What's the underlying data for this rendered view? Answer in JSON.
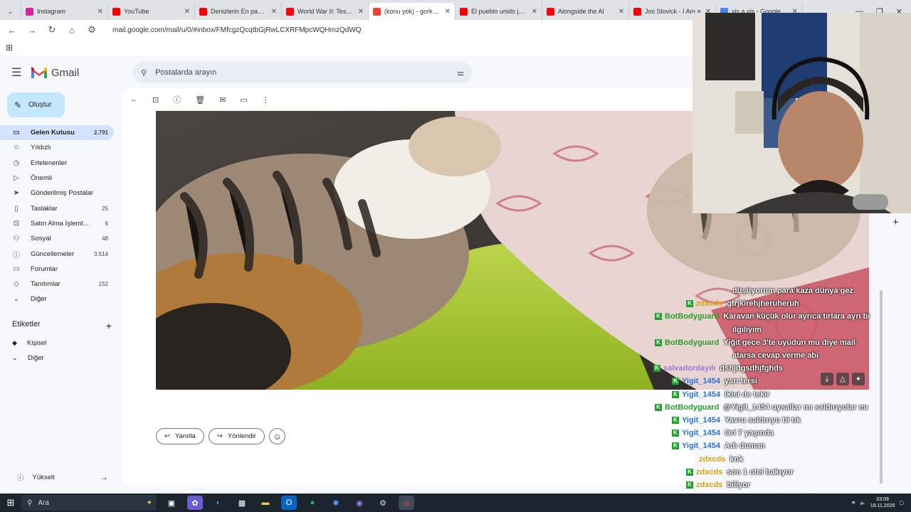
{
  "browser": {
    "tabs": [
      {
        "title": "Instagram",
        "color": "#d6249f"
      },
      {
        "title": "YouTube",
        "color": "#ff0000"
      },
      {
        "title": "Denizlerin En pahalı b",
        "color": "#ff0000"
      },
      {
        "title": "World War II: Test You",
        "color": "#ff0000"
      },
      {
        "title": "(konu yok) - gorkem",
        "color": "#ea4335"
      },
      {
        "title": "El pueblo unido jamá",
        "color": "#ff0000"
      },
      {
        "title": "Alongside the Al",
        "color": "#ff0000"
      },
      {
        "title": "Jos Slovick - I Am a",
        "color": "#ff0000"
      },
      {
        "title": "vis a vis - Google'da",
        "color": "#4285f4"
      }
    ],
    "url": "mail.google.com/mail/u/0/#inbox/FMfcgzQcqtbGjRwLCXRFMpcWQHmzQdWQ"
  },
  "gmail": {
    "app_name": "Gmail",
    "search_placeholder": "Postalarda arayın",
    "compose_label": "Oluştur",
    "nav": [
      {
        "label": "Gelen Kutusu",
        "count": "2.791",
        "icon": "inbox-icon",
        "glyph": "▭",
        "active": true
      },
      {
        "label": "Yıldızlı",
        "count": "",
        "icon": "star-icon",
        "glyph": "☆"
      },
      {
        "label": "Ertelenenler",
        "count": "",
        "icon": "clock-icon",
        "glyph": "◷"
      },
      {
        "label": "Önemli",
        "count": "",
        "icon": "important-icon",
        "glyph": "▷"
      },
      {
        "label": "Gönderilmiş Postalar",
        "count": "",
        "icon": "send-icon",
        "glyph": "➤"
      },
      {
        "label": "Taslaklar",
        "count": "25",
        "icon": "draft-icon",
        "glyph": "▯"
      },
      {
        "label": "Satın Alma İşleml...",
        "count": "6",
        "icon": "cart-icon",
        "glyph": "⊡"
      },
      {
        "label": "Sosyal",
        "count": "48",
        "icon": "people-icon",
        "glyph": "⚇"
      },
      {
        "label": "Güncellemeler",
        "count": "3.514",
        "icon": "info-icon",
        "glyph": "ⓘ"
      },
      {
        "label": "Forumlar",
        "count": "",
        "icon": "forum-icon",
        "glyph": "▭"
      },
      {
        "label": "Tanıtımlar",
        "count": "152",
        "icon": "tag-icon",
        "glyph": "◇"
      },
      {
        "label": "Diğer",
        "count": "",
        "icon": "chevron-down-icon",
        "glyph": "⌄"
      }
    ],
    "labels_title": "Etiketler",
    "labels": [
      {
        "label": "Kişisel",
        "glyph": "◆",
        "icon": "label-icon"
      },
      {
        "label": "Diğer",
        "glyph": "⌄",
        "icon": "chevron-down-icon"
      }
    ],
    "upgrade_label": "Yükselt",
    "reply_label": "Yanıtla",
    "forward_label": "Yönlendir"
  },
  "chat": [
    {
      "name": "",
      "badge": false,
      "color": "#ffffff",
      "text": "düşüyorum para kaza dünya gez",
      "indent": 117
    },
    {
      "name": "zdxcds",
      "badge": true,
      "color": "#d8a200",
      "text": "gtrjkirehjheruheruh",
      "indent": 52
    },
    {
      "name": "BotBodyguard",
      "badge": true,
      "color": "#2e9e2e",
      "text": "Karavan küçük olur ayrıca tırlara ayrı bi",
      "indent": 8
    },
    {
      "name": "",
      "badge": false,
      "color": "#ffffff",
      "text": "ilgiliyim",
      "indent": 117
    },
    {
      "name": "BotBodyguard",
      "badge": true,
      "color": "#2e9e2e",
      "text": "Yiğit gece 3'te uyudun mu diye mail",
      "indent": 8
    },
    {
      "name": "",
      "badge": false,
      "color": "#ffffff",
      "text": "atarsa cevap verme abi",
      "indent": 117
    },
    {
      "name": "salvadordayılı",
      "badge": true,
      "color": "#a07ad8",
      "text": "dshjdgsdhjfghds",
      "indent": 6
    },
    {
      "name": "Yigit_1454",
      "badge": true,
      "color": "#2c6fd6",
      "text": "yarı tersi",
      "indent": 32
    },
    {
      "name": "Yigit_1454",
      "badge": true,
      "color": "#2c6fd6",
      "text": "ikisi de tekir",
      "indent": 32
    },
    {
      "name": "BotBodyguard",
      "badge": true,
      "color": "#2e9e2e",
      "text": "@Yigit_1454 uysallar mı saldırıyolar mı",
      "indent": 8
    },
    {
      "name": "Yigit_1454",
      "badge": true,
      "color": "#2c6fd6",
      "text": "Yavru saldırıyo bi tık",
      "indent": 32
    },
    {
      "name": "Yigit_1454",
      "badge": true,
      "color": "#2c6fd6",
      "text": "Ori 7 yaşında",
      "indent": 32
    },
    {
      "name": "Yigit_1454",
      "badge": true,
      "color": "#2c6fd6",
      "text": "Adı duman",
      "indent": 32
    },
    {
      "name": "zdxcds",
      "badge": false,
      "color": "#d8a200",
      "text": "knk",
      "indent": 70
    },
    {
      "name": "zdxcds",
      "badge": true,
      "color": "#d8a200",
      "text": "son 1 otel bakıyor",
      "indent": 52
    },
    {
      "name": "zdxcds",
      "badge": true,
      "color": "#d8a200",
      "text": "biliyor",
      "indent": 52
    },
    {
      "name": "BotBodyguard",
      "badge": true,
      "color": "#2e9e2e",
      "text": "Kürt sosunda ayrı bi hastayım yaa",
      "indent": 26
    }
  ],
  "taskbar": {
    "search_label": "Ara",
    "time": "03:09",
    "date": "19.11.2025"
  }
}
